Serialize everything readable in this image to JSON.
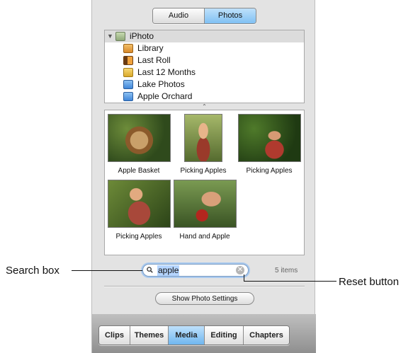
{
  "media_switch": {
    "audio_label": "Audio",
    "photos_label": "Photos",
    "selected": "Photos"
  },
  "source_list": {
    "parent": {
      "label": "iPhoto",
      "icon": "iphoto-icon"
    },
    "children": [
      {
        "label": "Library",
        "icon": "library-icon"
      },
      {
        "label": "Last Roll",
        "icon": "last-roll-icon"
      },
      {
        "label": "Last 12 Months",
        "icon": "calendar-icon"
      },
      {
        "label": "Lake Photos",
        "icon": "album-icon"
      },
      {
        "label": "Apple Orchard",
        "icon": "album-icon"
      }
    ],
    "splitter_glyph": "⌃"
  },
  "photos": [
    {
      "caption": "Apple Basket"
    },
    {
      "caption": "Picking Apples"
    },
    {
      "caption": "Picking Apples"
    },
    {
      "caption": "Picking Apples"
    },
    {
      "caption": "Hand and Apple"
    }
  ],
  "search": {
    "value": "apple",
    "count": "5 items"
  },
  "settings_button": "Show Photo Settings",
  "tabs": [
    {
      "label": "Clips"
    },
    {
      "label": "Themes"
    },
    {
      "label": "Media"
    },
    {
      "label": "Editing"
    },
    {
      "label": "Chapters"
    }
  ],
  "active_tab": "Media",
  "callouts": {
    "search_box": "Search box",
    "reset_button": "Reset button"
  },
  "colors": {
    "selected_segment": "#7fc0f3",
    "search_highlight": "#b5d5ff"
  }
}
